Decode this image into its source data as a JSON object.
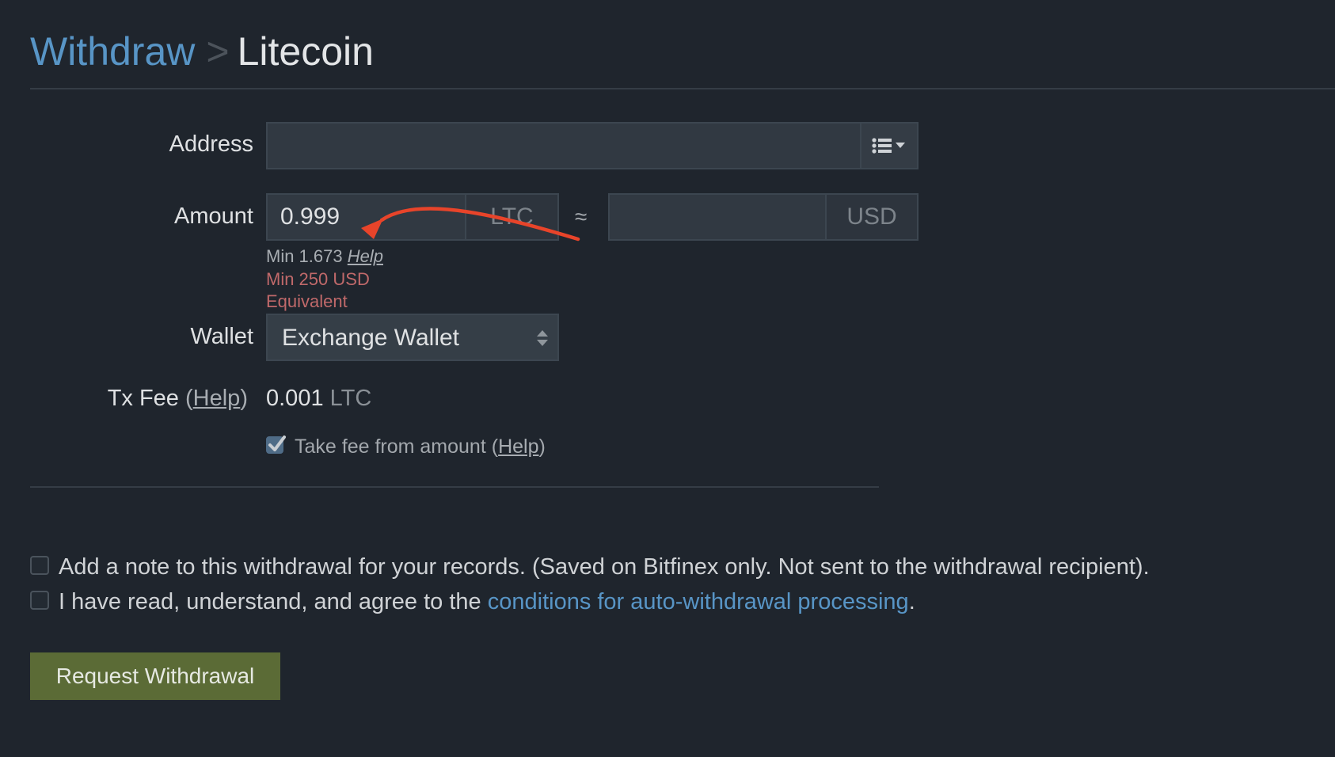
{
  "header": {
    "breadcrumb_parent": "Withdraw",
    "separator": ">",
    "current": "Litecoin"
  },
  "form": {
    "address": {
      "label": "Address",
      "value": "",
      "address_book_icon": "list-dropdown-icon"
    },
    "amount": {
      "label": "Amount",
      "value": "0.999",
      "currency": "LTC",
      "approx_symbol": "≈",
      "usd_value": "",
      "usd_currency": "USD",
      "min_text": "Min 1.673",
      "min_help": "Help",
      "error_line1": "Min 250 USD",
      "error_line2": "Equivalent"
    },
    "wallet": {
      "label": "Wallet",
      "selected": "Exchange Wallet"
    },
    "tx_fee": {
      "label": "Tx Fee",
      "help": "Help",
      "value": "0.001",
      "unit": "LTC"
    },
    "take_fee": {
      "checked": true,
      "label": "Take fee from amount",
      "help": "Help"
    }
  },
  "agreements": {
    "note": {
      "checked": false,
      "label": "Add a note to this withdrawal for your records. (Saved on Bitfinex only. Not sent to the withdrawal recipient)."
    },
    "conditions": {
      "checked": false,
      "label_prefix": "I have read, understand, and agree to the ",
      "link": "conditions for auto-withdrawal processing",
      "label_suffix": "."
    }
  },
  "submit": {
    "label": "Request Withdrawal"
  },
  "colors": {
    "background": "#1f252d",
    "accent_link": "#5895c6",
    "error": "#c0696a",
    "button": "#5b6b36",
    "annotation_arrow": "#e8442a"
  }
}
